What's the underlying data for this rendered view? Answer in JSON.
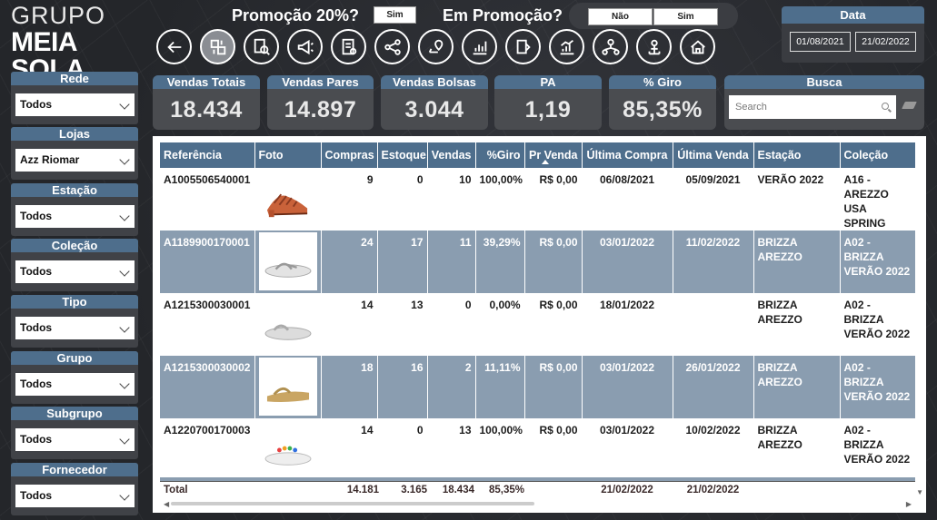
{
  "header": {
    "logo_line1": "GRUPO",
    "logo_line2": "MEIA SOLA",
    "promo20_label": "Promoção 20%?",
    "promo20_option": "Sim",
    "em_promocao_label": "Em Promoção?",
    "em_promocao_options": [
      "Não",
      "Sim"
    ]
  },
  "nav_icons": [
    "back-arrow-icon",
    "swap-icon",
    "search-report-icon",
    "megaphone-icon",
    "invoice-icon",
    "share-icon",
    "map-pin-icon",
    "bar-chart-icon",
    "document-export-icon",
    "growth-chart-icon",
    "org-chart-icon",
    "network-user-icon",
    "home-icon"
  ],
  "date": {
    "title": "Data",
    "start": "01/08/2021",
    "end": "21/02/2022"
  },
  "filters": [
    {
      "title": "Rede",
      "value": "Todos"
    },
    {
      "title": "Lojas",
      "value": "Azz Riomar"
    },
    {
      "title": "Estação",
      "value": "Todos"
    },
    {
      "title": "Coleção",
      "value": "Todos"
    },
    {
      "title": "Tipo",
      "value": "Todos"
    },
    {
      "title": "Grupo",
      "value": "Todos"
    },
    {
      "title": "Subgrupo",
      "value": "Todos"
    },
    {
      "title": "Fornecedor",
      "value": "Todos"
    }
  ],
  "kpis": [
    {
      "title": "Vendas Totais",
      "value": "18.434"
    },
    {
      "title": "Vendas Pares",
      "value": "14.897"
    },
    {
      "title": "Vendas Bolsas",
      "value": "3.044"
    },
    {
      "title": "PA",
      "value": "1,19"
    },
    {
      "title": "% Giro",
      "value": "85,35%"
    }
  ],
  "busca": {
    "title": "Busca",
    "placeholder": "Search"
  },
  "table": {
    "columns": [
      "Referência",
      "Foto",
      "Compras",
      "Estoque",
      "Vendas",
      "%Giro",
      "Pr Venda",
      "Última Compra",
      "Última Venda",
      "Estação",
      "Coleção"
    ],
    "rows": [
      {
        "ref": "A1005506540001",
        "compras": "9",
        "estoque": "0",
        "vendas": "10",
        "giro": "100,00%",
        "preco": "R$ 0,00",
        "ult_compra": "06/08/2021",
        "ult_venda": "05/09/2021",
        "estacao": "VERÃO 2022",
        "colecao": "A16 - AREZZO USA SPRING"
      },
      {
        "ref": "A1189900170001",
        "compras": "24",
        "estoque": "17",
        "vendas": "11",
        "giro": "39,29%",
        "preco": "R$ 0,00",
        "ult_compra": "03/01/2022",
        "ult_venda": "11/02/2022",
        "estacao": "BRIZZA AREZZO",
        "colecao": "A02 - BRIZZA VERÃO 2022"
      },
      {
        "ref": "A1215300030001",
        "compras": "14",
        "estoque": "13",
        "vendas": "0",
        "giro": "0,00%",
        "preco": "R$ 0,00",
        "ult_compra": "18/01/2022",
        "ult_venda": "",
        "estacao": "BRIZZA AREZZO",
        "colecao": "A02 - BRIZZA VERÃO 2022"
      },
      {
        "ref": "A1215300030002",
        "compras": "18",
        "estoque": "16",
        "vendas": "2",
        "giro": "11,11%",
        "preco": "R$ 0,00",
        "ult_compra": "03/01/2022",
        "ult_venda": "26/01/2022",
        "estacao": "BRIZZA AREZZO",
        "colecao": "A02 - BRIZZA VERÃO 2022"
      },
      {
        "ref": "A1220700170003",
        "compras": "14",
        "estoque": "0",
        "vendas": "13",
        "giro": "100,00%",
        "preco": "R$ 0,00",
        "ult_compra": "03/01/2022",
        "ult_venda": "10/02/2022",
        "estacao": "BRIZZA AREZZO",
        "colecao": "A02 - BRIZZA VERÃO 2022"
      }
    ],
    "total": {
      "label": "Total",
      "compras": "14.181",
      "estoque": "3.165",
      "vendas": "18.434",
      "giro": "85,35%",
      "ult_compra": "21/02/2022",
      "ult_venda": "21/02/2022"
    }
  },
  "colors": {
    "accent": "#4e6e8c",
    "row_alt": "#8a9db0",
    "background": "#2a2c31"
  }
}
